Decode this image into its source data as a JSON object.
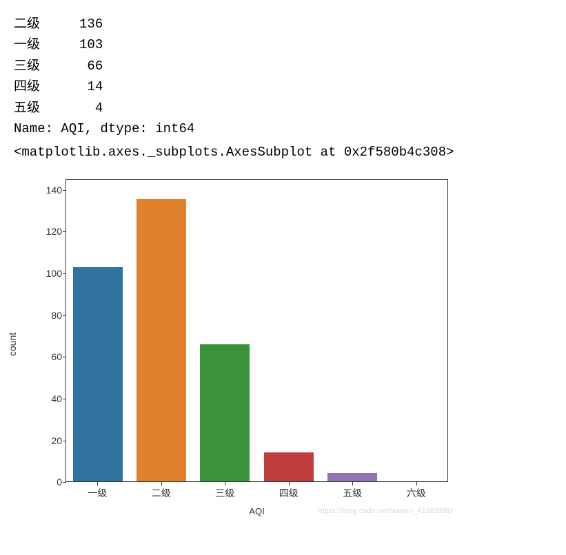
{
  "series_output": {
    "rows": [
      {
        "label": "二级",
        "value": "136"
      },
      {
        "label": "一级",
        "value": "103"
      },
      {
        "label": "三级",
        "value": " 66"
      },
      {
        "label": "四级",
        "value": " 14"
      },
      {
        "label": "五级",
        "value": "  4"
      }
    ],
    "footer": "Name: AQI, dtype: int64"
  },
  "repr": "<matplotlib.axes._subplots.AxesSubplot at 0x2f580b4c308>",
  "chart_data": {
    "type": "bar",
    "title": "",
    "xlabel": "AQI",
    "ylabel": "count",
    "ylim": [
      0,
      145
    ],
    "yticks": [
      0,
      20,
      40,
      60,
      80,
      100,
      120,
      140
    ],
    "categories": [
      "一级",
      "二级",
      "三级",
      "四级",
      "五级",
      "六级"
    ],
    "values": [
      103,
      136,
      66,
      14,
      4,
      0
    ],
    "colors": [
      "#3274a1",
      "#e1812c",
      "#3a923a",
      "#c03d3e",
      "#9372b2",
      "#845b53"
    ]
  },
  "watermark": "https://blog.csdn.net/weixin_41882890"
}
